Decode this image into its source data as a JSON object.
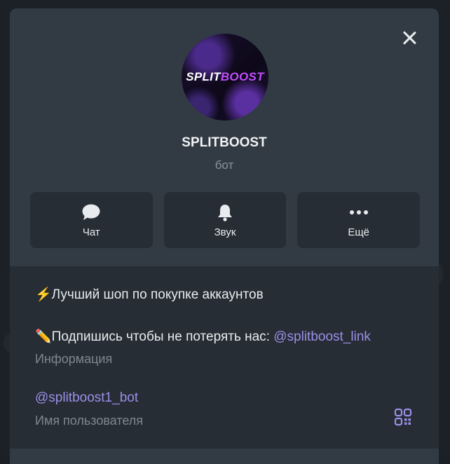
{
  "profile": {
    "avatar_text_white": "SPLIT",
    "avatar_text_purple": "BOOST",
    "name": "SPLITBOOST",
    "subtitle": "бот"
  },
  "actions": [
    {
      "label": "Чат",
      "icon": "chat-bubble-icon"
    },
    {
      "label": "Звук",
      "icon": "bell-icon"
    },
    {
      "label": "Ещё",
      "icon": "more-dots-icon"
    }
  ],
  "info": {
    "line1_emoji": "⚡",
    "line1_text": "Лучший шоп по покупке аккаунтов",
    "line2_emoji": "✏️",
    "line2_text": "Подпишись чтобы не потерять нас: ",
    "line2_link": "@splitboost_link",
    "info_caption": "Информация",
    "username": "@splitboost1_bot",
    "username_caption": "Имя пользователя"
  },
  "colors": {
    "accent_link": "#9a8fe8",
    "panel": "#323b43",
    "card": "#262d34"
  }
}
